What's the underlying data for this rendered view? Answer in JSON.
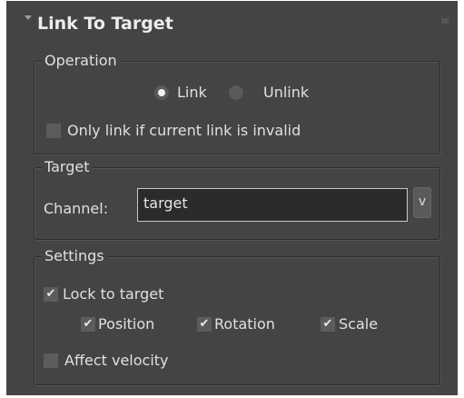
{
  "panel": {
    "title": "Link To Target"
  },
  "operation": {
    "legend": "Operation",
    "options": [
      {
        "label": "Link",
        "selected": true
      },
      {
        "label": "Unlink",
        "selected": false
      }
    ],
    "only_link_invalid": {
      "label": "Only link if current link is invalid",
      "checked": false
    }
  },
  "target": {
    "legend": "Target",
    "channel_label": "Channel:",
    "channel_value": "target",
    "dropdown_label": "v"
  },
  "settings": {
    "legend": "Settings",
    "lock_to_target": {
      "label": "Lock to target",
      "checked": true
    },
    "position": {
      "label": "Position",
      "checked": true
    },
    "rotation": {
      "label": "Rotation",
      "checked": true
    },
    "scale": {
      "label": "Scale",
      "checked": true
    },
    "affect_velocity": {
      "label": "Affect velocity",
      "checked": false
    }
  },
  "icons": {
    "collapse": "collapse-triangle-icon",
    "grip": "drag-grip-icon",
    "check": "✔"
  },
  "colors": {
    "panel_bg": "#444444",
    "field_bg": "#2b2b2b",
    "text": "#e2e2e2"
  }
}
